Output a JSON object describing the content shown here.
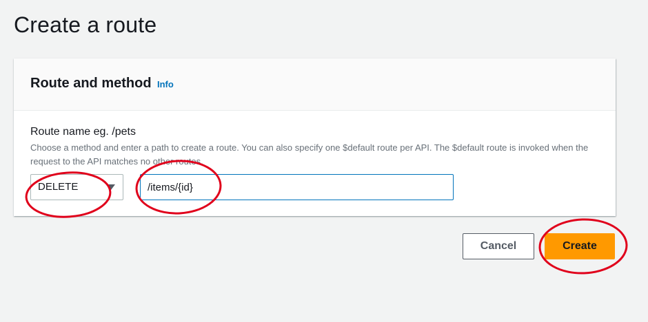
{
  "page": {
    "title": "Create a route"
  },
  "panel": {
    "heading": "Route and method",
    "info_link": "Info",
    "field_label": "Route name eg. /pets",
    "field_description": "Choose a method and enter a path to create a route. You can also specify one $default route per API. The $default route is invoked when the request to the API matches no other routes.",
    "method_selected": "DELETE",
    "path_value": "/items/{id}"
  },
  "actions": {
    "cancel_label": "Cancel",
    "create_label": "Create"
  },
  "colors": {
    "primary": "#ff9900",
    "link": "#0073bb",
    "annotation": "#e0001b"
  },
  "icons": {
    "select_caret": "caret-down-icon"
  }
}
